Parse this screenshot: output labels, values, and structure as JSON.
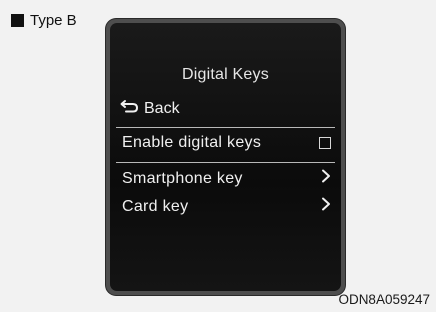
{
  "type_label": "Type B",
  "screen": {
    "title": "Digital Keys",
    "back_label": "Back",
    "items": [
      {
        "label": "Enable digital keys",
        "control": "checkbox",
        "checked": false
      },
      {
        "label": "Smartphone key",
        "control": "chevron"
      },
      {
        "label": "Card key",
        "control": "chevron"
      }
    ]
  },
  "caption": "ODN8A059247",
  "colors": {
    "background": "#f2f2f2",
    "screen_bg": "#111111",
    "screen_text": "#f0f0f0",
    "frame": "#4e4e4e"
  },
  "icons": {
    "type_marker": "square-icon",
    "back": "back-arrow-icon",
    "checkbox": "checkbox-icon",
    "chevron": "chevron-right-icon"
  }
}
